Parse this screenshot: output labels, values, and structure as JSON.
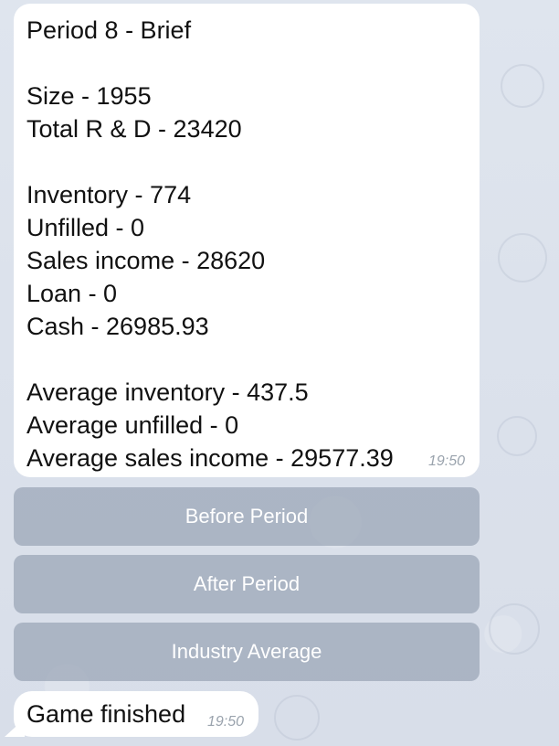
{
  "brief_message": {
    "lines": [
      "Period 8 - Brief",
      "",
      "Size - 1955",
      "Total R & D - 23420",
      "",
      "Inventory - 774",
      "Unfilled - 0",
      "Sales income - 28620",
      "Loan - 0",
      "Cash - 26985.93",
      "",
      "Average inventory - 437.5",
      "Average unfilled - 0",
      "Average sales income - 29577.39"
    ],
    "time": "19:50"
  },
  "keyboard": {
    "buttons": [
      "Before Period",
      "After Period",
      "Industry Average"
    ]
  },
  "final_message": {
    "text": "Game finished",
    "time": "19:50"
  },
  "colors": {
    "chat_background": "#dde3ec",
    "bubble_background": "#ffffff",
    "keyboard_button_background": "#8a96a8",
    "timestamp": "#9aa3ad"
  }
}
